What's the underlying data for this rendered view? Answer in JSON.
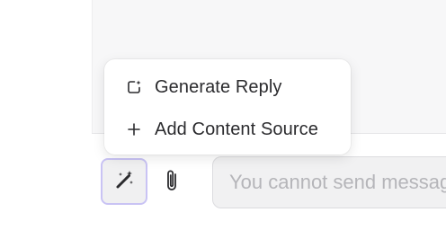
{
  "menu": {
    "items": [
      {
        "label": "Generate Reply",
        "icon": "generate-reply-icon"
      },
      {
        "label": "Add Content Source",
        "icon": "plus-icon"
      }
    ]
  },
  "composer": {
    "magic_button_icon": "magic-wand-icon",
    "attach_button_icon": "paperclip-icon",
    "input_placeholder": "You cannot send messages"
  },
  "colors": {
    "accent_border": "#c9c3f4",
    "text": "#2b2b2e",
    "placeholder": "#b5b5b9"
  }
}
